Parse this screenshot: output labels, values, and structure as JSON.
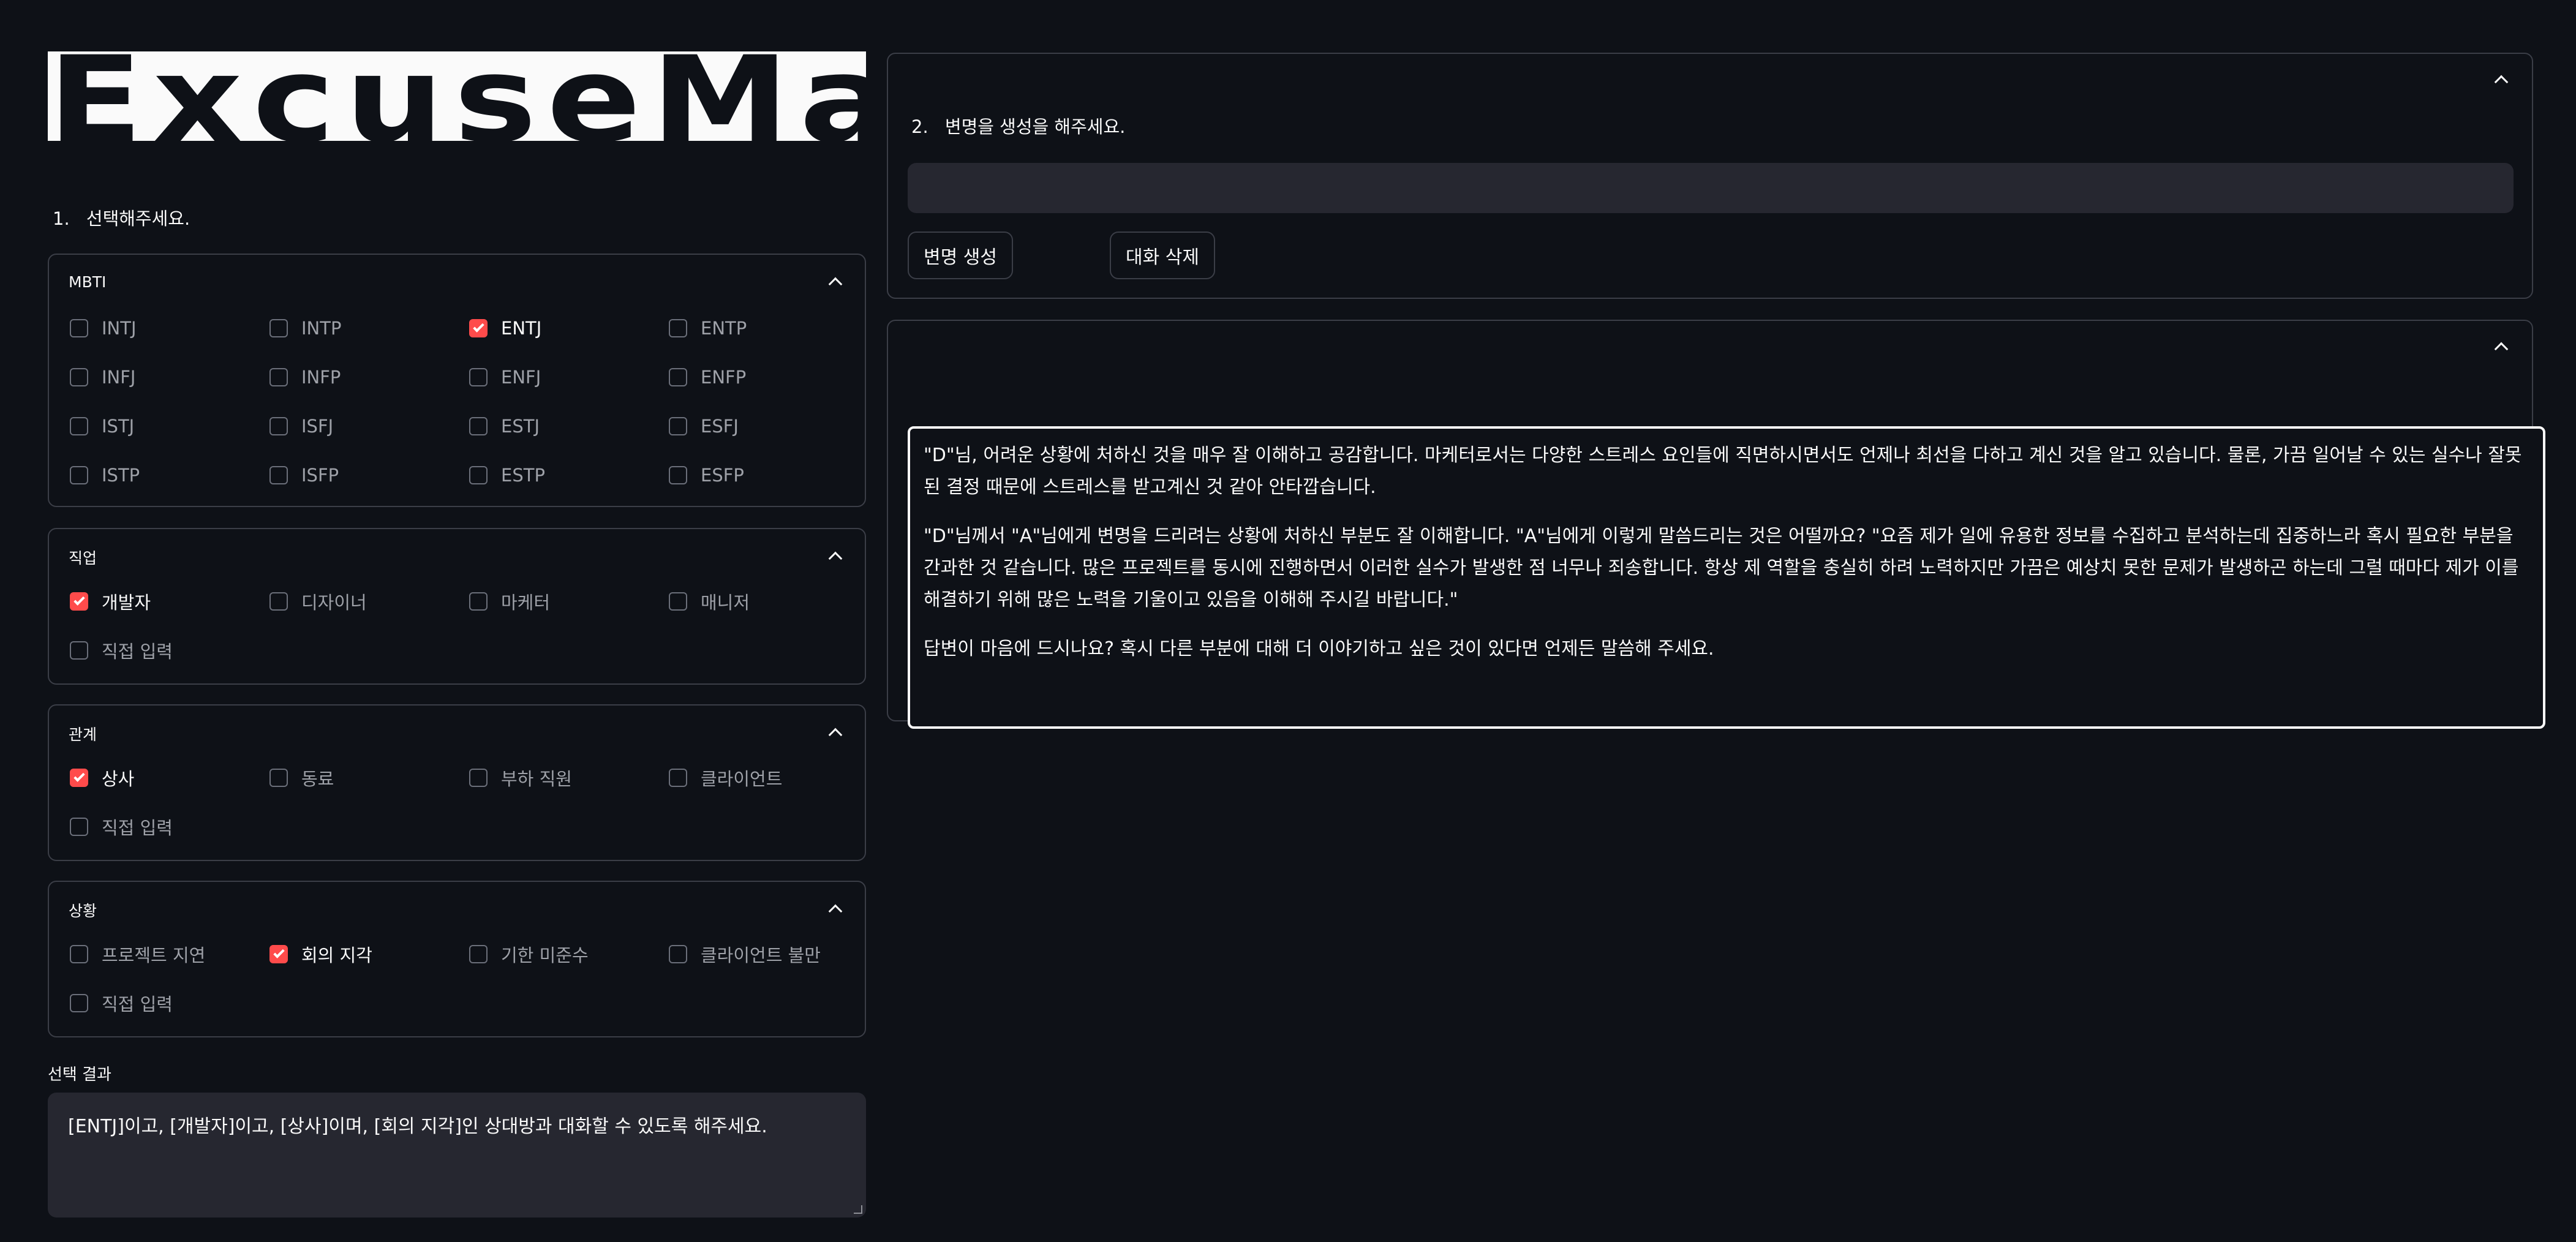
{
  "app": {
    "title": "ExcuseMate"
  },
  "left": {
    "step1": {
      "num": "1.",
      "text": "선택해주세요."
    },
    "groups": [
      {
        "title": "MBTI",
        "options": [
          {
            "label": "INTJ",
            "checked": false
          },
          {
            "label": "INTP",
            "checked": false
          },
          {
            "label": "ENTJ",
            "checked": true
          },
          {
            "label": "ENTP",
            "checked": false
          },
          {
            "label": "INFJ",
            "checked": false
          },
          {
            "label": "INFP",
            "checked": false
          },
          {
            "label": "ENFJ",
            "checked": false
          },
          {
            "label": "ENFP",
            "checked": false
          },
          {
            "label": "ISTJ",
            "checked": false
          },
          {
            "label": "ISFJ",
            "checked": false
          },
          {
            "label": "ESTJ",
            "checked": false
          },
          {
            "label": "ESFJ",
            "checked": false
          },
          {
            "label": "ISTP",
            "checked": false
          },
          {
            "label": "ISFP",
            "checked": false
          },
          {
            "label": "ESTP",
            "checked": false
          },
          {
            "label": "ESFP",
            "checked": false
          }
        ]
      },
      {
        "title": "직업",
        "options": [
          {
            "label": "개발자",
            "checked": true
          },
          {
            "label": "디자이너",
            "checked": false
          },
          {
            "label": "마케터",
            "checked": false
          },
          {
            "label": "매니저",
            "checked": false
          },
          {
            "label": "직접 입력",
            "checked": false
          }
        ]
      },
      {
        "title": "관계",
        "options": [
          {
            "label": "상사",
            "checked": true
          },
          {
            "label": "동료",
            "checked": false
          },
          {
            "label": "부하 직원",
            "checked": false
          },
          {
            "label": "클라이언트",
            "checked": false
          },
          {
            "label": "직접 입력",
            "checked": false
          }
        ]
      },
      {
        "title": "상황",
        "options": [
          {
            "label": "프로젝트 지연",
            "checked": false
          },
          {
            "label": "회의 지각",
            "checked": true
          },
          {
            "label": "기한 미준수",
            "checked": false
          },
          {
            "label": "클라이언트 불만",
            "checked": false
          },
          {
            "label": "직접 입력",
            "checked": false
          }
        ]
      }
    ],
    "result": {
      "label": "선택 결과",
      "value": "[ENTJ]이고, [개발자]이고, [상사]이며, [회의 지각]인 상대방과 대화할 수 있도록 해주세요."
    }
  },
  "right": {
    "step2": {
      "num": "2.",
      "text": "변명을 생성을 해주세요."
    },
    "chat_input": {
      "value": ""
    },
    "buttons": {
      "generate": "변명 생성",
      "delete": "대화 삭제"
    },
    "answer": [
      "\"D\"님, 어려운 상황에 처하신 것을 매우 잘 이해하고 공감합니다. 마케터로서는 다양한 스트레스 요인들에 직면하시면서도 언제나 최선을 다하고 계신 것을 알고 있습니다. 물론, 가끔 일어날 수 있는 실수나 잘못된 결정 때문에 스트레스를 받고계신 것 같아 안타깝습니다.",
      "\"D\"님께서 \"A\"님에게 변명을 드리려는 상황에 처하신 부분도 잘 이해합니다. \"A\"님에게 이렇게 말씀드리는 것은 어떨까요? \"요즘 제가 일에 유용한 정보를 수집하고 분석하는데 집중하느라 혹시 필요한 부분을 간과한 것 같습니다. 많은 프로젝트를 동시에 진행하면서 이러한 실수가 발생한 점 너무나 죄송합니다. 항상 제 역할을 충실히 하려 노력하지만 가끔은 예상치 못한 문제가 발생하곤 하는데 그럴 때마다 제가 이를 해결하기 위해 많은 노력을 기울이고 있음을 이해해 주시길 바랍니다.\"",
      "답변이 마음에 드시나요? 혹시 다른 부분에 대해 더 이야기하고 싶은 것이 있다면 언제든 말씀해 주세요."
    ]
  }
}
